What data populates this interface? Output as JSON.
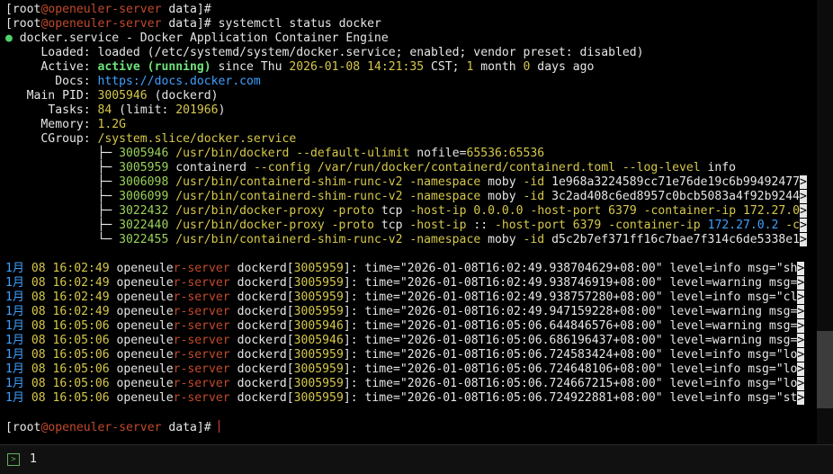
{
  "prompt": {
    "open": "[",
    "user": "root",
    "at": "@",
    "host": "openeuler-server",
    "space": " ",
    "dir": "data",
    "close": "]",
    "sym": "# "
  },
  "command": "systemctl status docker",
  "status": {
    "dot": "●",
    "service": "docker.service - Docker Application Container Engine",
    "loaded_label": "Loaded:",
    "loaded_value": "loaded (/etc/systemd/system/docker.service; enabled; vendor preset: disabled)",
    "active_label": "Active:",
    "active_state": "active (running)",
    "since_prefix": " since Thu ",
    "since_time": "2026-01-08 14:21:35",
    "tz": " CST; ",
    "uptime_n1": "1",
    "uptime_t1": " month ",
    "uptime_n2": "0",
    "uptime_t2": " days ago",
    "docs_label": "Docs:",
    "docs_url": "https://docs.docker.com",
    "pid_label": "Main PID:",
    "pid_value": "3005946",
    "pid_name": " (dockerd)",
    "tasks_label": "Tasks:",
    "tasks_value": "84",
    "tasks_limit_pre": " (limit: ",
    "tasks_limit": "201966",
    "tasks_limit_post": ")",
    "memory_label": "Memory:",
    "memory_value": "1.2G",
    "cgroup_label": "CGroup:",
    "cgroup_value": "/system.slice/docker.service"
  },
  "cgroup_tree": [
    {
      "branch": "├─ ",
      "pid": "3005946",
      "segs": [
        [
          "y",
          "/usr/bin/dockerd"
        ],
        [
          "w",
          " "
        ],
        [
          "y",
          "--default-ulimit"
        ],
        [
          "w",
          " nofile="
        ],
        [
          "y",
          "65536:65536"
        ]
      ],
      "trunc": false
    },
    {
      "branch": "├─ ",
      "pid": "3005959",
      "segs": [
        [
          "w",
          "containerd "
        ],
        [
          "y",
          "--config"
        ],
        [
          "w",
          " "
        ],
        [
          "y",
          "/var/run/docker/containerd/containerd.toml"
        ],
        [
          "w",
          " "
        ],
        [
          "y",
          "--log-level"
        ],
        [
          "w",
          " info"
        ]
      ],
      "trunc": false
    },
    {
      "branch": "├─ ",
      "pid": "3006098",
      "segs": [
        [
          "y",
          "/usr/bin/containerd-shim-runc-v2"
        ],
        [
          "w",
          " "
        ],
        [
          "y",
          "-namespace"
        ],
        [
          "w",
          " moby "
        ],
        [
          "y",
          "-id"
        ],
        [
          "w",
          " 1e968a3224589cc71e76de19c6b99492477"
        ]
      ],
      "trunc": true
    },
    {
      "branch": "├─ ",
      "pid": "3006099",
      "segs": [
        [
          "y",
          "/usr/bin/containerd-shim-runc-v2"
        ],
        [
          "w",
          " "
        ],
        [
          "y",
          "-namespace"
        ],
        [
          "w",
          " moby "
        ],
        [
          "y",
          "-id"
        ],
        [
          "w",
          " 3c2ad408c6ed8957c0bcb5083a4f92b9244"
        ]
      ],
      "trunc": true
    },
    {
      "branch": "├─ ",
      "pid": "3022432",
      "segs": [
        [
          "y",
          "/usr/bin/docker-proxy"
        ],
        [
          "w",
          " "
        ],
        [
          "y",
          "-proto"
        ],
        [
          "w",
          " tcp "
        ],
        [
          "y",
          "-host-ip"
        ],
        [
          "w",
          " "
        ],
        [
          "y",
          "0.0.0.0"
        ],
        [
          "w",
          " "
        ],
        [
          "y",
          "-host-port"
        ],
        [
          "w",
          " "
        ],
        [
          "y",
          "6379"
        ],
        [
          "w",
          " "
        ],
        [
          "y",
          "-container-ip"
        ],
        [
          "w",
          " "
        ],
        [
          "y",
          "172.27.0"
        ]
      ],
      "trunc": true
    },
    {
      "branch": "├─ ",
      "pid": "3022440",
      "segs": [
        [
          "y",
          "/usr/bin/docker-proxy"
        ],
        [
          "w",
          " "
        ],
        [
          "y",
          "-proto"
        ],
        [
          "w",
          " tcp "
        ],
        [
          "y",
          "-host-ip"
        ],
        [
          "w",
          " :: "
        ],
        [
          "y",
          "-host-port"
        ],
        [
          "w",
          " "
        ],
        [
          "y",
          "6379"
        ],
        [
          "w",
          " "
        ],
        [
          "y",
          "-container-ip"
        ],
        [
          "w",
          " "
        ],
        [
          "b",
          "172.27.0.2"
        ],
        [
          "w",
          " "
        ],
        [
          "y",
          "-c"
        ]
      ],
      "trunc": true
    },
    {
      "branch": "└─ ",
      "pid": "3022455",
      "segs": [
        [
          "y",
          "/usr/bin/containerd-shim-runc-v2"
        ],
        [
          "w",
          " "
        ],
        [
          "y",
          "-namespace"
        ],
        [
          "w",
          " moby "
        ],
        [
          "y",
          "-id"
        ],
        [
          "w",
          " d5c2b7ef371ff16c7bae7f314c6de5338e1"
        ]
      ],
      "trunc": true
    }
  ],
  "logs": [
    {
      "month": "1月",
      "day": "08",
      "time": "16:02:49",
      "host_a": "openeule",
      "host_b": "r-server",
      "proc": "dockerd",
      "pid": "3005959",
      "ts": "\"2026-01-08T16:02:49.938704629+08:00\"",
      "level": "level=info msg=\"sh"
    },
    {
      "month": "1月",
      "day": "08",
      "time": "16:02:49",
      "host_a": "openeule",
      "host_b": "r-server",
      "proc": "dockerd",
      "pid": "3005959",
      "ts": "\"2026-01-08T16:02:49.938746919+08:00\"",
      "level": "level=warning msg="
    },
    {
      "month": "1月",
      "day": "08",
      "time": "16:02:49",
      "host_a": "openeule",
      "host_b": "r-server",
      "proc": "dockerd",
      "pid": "3005959",
      "ts": "\"2026-01-08T16:02:49.938757280+08:00\"",
      "level": "level=info msg=\"cl"
    },
    {
      "month": "1月",
      "day": "08",
      "time": "16:02:49",
      "host_a": "openeule",
      "host_b": "r-server",
      "proc": "dockerd",
      "pid": "3005959",
      "ts": "\"2026-01-08T16:02:49.947159228+08:00\"",
      "level": "level=warning msg="
    },
    {
      "month": "1月",
      "day": "08",
      "time": "16:05:06",
      "host_a": "openeule",
      "host_b": "r-server",
      "proc": "dockerd",
      "pid": "3005946",
      "ts": "\"2026-01-08T16:05:06.644846576+08:00\"",
      "level": "level=warning msg="
    },
    {
      "month": "1月",
      "day": "08",
      "time": "16:05:06",
      "host_a": "openeule",
      "host_b": "r-server",
      "proc": "dockerd",
      "pid": "3005946",
      "ts": "\"2026-01-08T16:05:06.686196437+08:00\"",
      "level": "level=warning msg="
    },
    {
      "month": "1月",
      "day": "08",
      "time": "16:05:06",
      "host_a": "openeule",
      "host_b": "r-server",
      "proc": "dockerd",
      "pid": "3005959",
      "ts": "\"2026-01-08T16:05:06.724583424+08:00\"",
      "level": "level=info msg=\"lo"
    },
    {
      "month": "1月",
      "day": "08",
      "time": "16:05:06",
      "host_a": "openeule",
      "host_b": "r-server",
      "proc": "dockerd",
      "pid": "3005959",
      "ts": "\"2026-01-08T16:05:06.724648106+08:00\"",
      "level": "level=info msg=\"lo"
    },
    {
      "month": "1月",
      "day": "08",
      "time": "16:05:06",
      "host_a": "openeule",
      "host_b": "r-server",
      "proc": "dockerd",
      "pid": "3005959",
      "ts": "\"2026-01-08T16:05:06.724667215+08:00\"",
      "level": "level=info msg=\"lo"
    },
    {
      "month": "1月",
      "day": "08",
      "time": "16:05:06",
      "host_a": "openeule",
      "host_b": "r-server",
      "proc": "dockerd",
      "pid": "3005959",
      "ts": "\"2026-01-08T16:05:06.724922881+08:00\"",
      "level": "level=info msg=\"st"
    }
  ],
  "log_parts": {
    "bracket_open": "[",
    "bracket_close": "]",
    "colon": ": ",
    "time_label": "time=",
    "trunc_mark": ">"
  },
  "footer": {
    "icon": "terminal-icon",
    "tab_number": "1"
  },
  "colors": {
    "prompt_host": "#c34a2c",
    "highlight": "#d6c84a",
    "active": "#4fd16a",
    "link": "#3fa0ff"
  }
}
